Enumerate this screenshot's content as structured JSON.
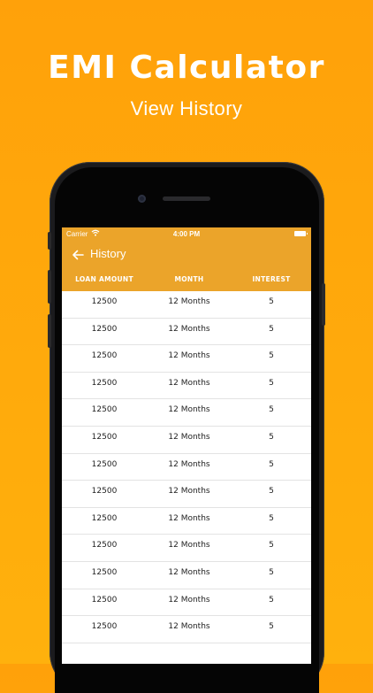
{
  "promo": {
    "title": "EMI Calculator",
    "subtitle": "View History"
  },
  "status_bar": {
    "carrier": "Carrier",
    "time": "4:00 PM"
  },
  "header": {
    "title": "History",
    "columns": [
      "LOAN AMOUNT",
      "MONTH",
      "INTEREST"
    ]
  },
  "colors": {
    "background": "#FFA10A",
    "header": "#EBA42A",
    "text_on_accent": "#FFFFFF"
  },
  "icons": [
    "wifi-icon",
    "battery-icon",
    "back-arrow-icon"
  ],
  "rows": [
    {
      "loan": "12500",
      "month": "12 Months",
      "interest": "5"
    },
    {
      "loan": "12500",
      "month": "12 Months",
      "interest": "5"
    },
    {
      "loan": "12500",
      "month": "12 Months",
      "interest": "5"
    },
    {
      "loan": "12500",
      "month": "12 Months",
      "interest": "5"
    },
    {
      "loan": "12500",
      "month": "12 Months",
      "interest": "5"
    },
    {
      "loan": "12500",
      "month": "12 Months",
      "interest": "5"
    },
    {
      "loan": "12500",
      "month": "12 Months",
      "interest": "5"
    },
    {
      "loan": "12500",
      "month": "12 Months",
      "interest": "5"
    },
    {
      "loan": "12500",
      "month": "12 Months",
      "interest": "5"
    },
    {
      "loan": "12500",
      "month": "12 Months",
      "interest": "5"
    },
    {
      "loan": "12500",
      "month": "12 Months",
      "interest": "5"
    },
    {
      "loan": "12500",
      "month": "12 Months",
      "interest": "5"
    },
    {
      "loan": "12500",
      "month": "12 Months",
      "interest": "5"
    }
  ]
}
